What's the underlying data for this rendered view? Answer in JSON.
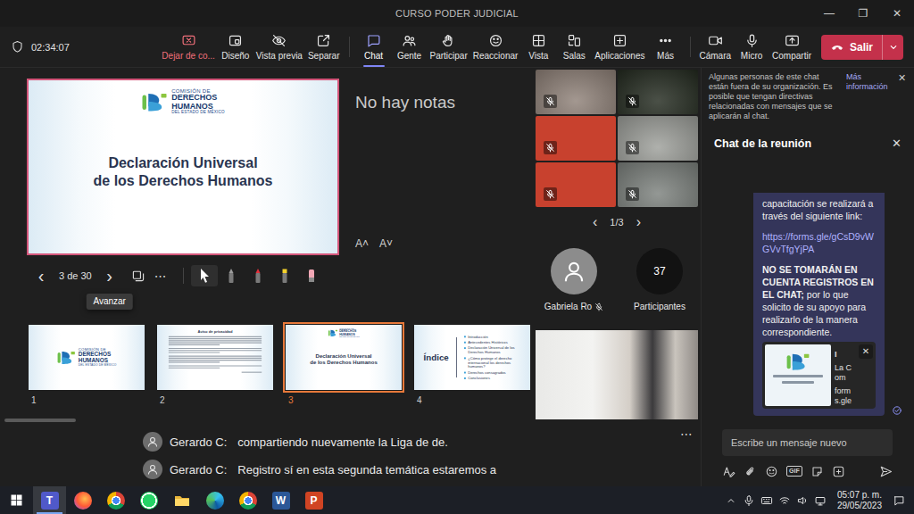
{
  "window": {
    "title": "CURSO PODER JUDICIAL",
    "controls": [
      "—",
      "❐",
      "✕"
    ]
  },
  "toolbar": {
    "timer": "02:34:07",
    "share_buttons": [
      {
        "label": "Dejar de co...",
        "kind": "stop",
        "selected": false
      },
      {
        "label": "Diseño",
        "kind": "normal",
        "selected": false
      },
      {
        "label": "Vista previa",
        "kind": "normal",
        "selected": false
      },
      {
        "label": "Separar",
        "kind": "normal",
        "selected": false
      }
    ],
    "meeting_buttons": [
      {
        "label": "Chat",
        "kind": "normal",
        "selected": true
      },
      {
        "label": "Gente",
        "kind": "normal",
        "selected": false
      },
      {
        "label": "Participar",
        "kind": "normal",
        "selected": false
      },
      {
        "label": "Reaccionar",
        "kind": "normal",
        "selected": false
      },
      {
        "label": "Vista",
        "kind": "normal",
        "selected": false
      },
      {
        "label": "Salas",
        "kind": "normal",
        "selected": false
      },
      {
        "label": "Aplicaciones",
        "kind": "normal",
        "selected": false
      },
      {
        "label": "Más",
        "kind": "normal",
        "selected": false
      }
    ],
    "device_buttons": [
      {
        "label": "Cámara",
        "kind": "normal",
        "selected": false
      },
      {
        "label": "Micro",
        "kind": "normal",
        "selected": false
      },
      {
        "label": "Compartir",
        "kind": "normal",
        "selected": false
      }
    ],
    "leave": {
      "label": "Salir"
    }
  },
  "presentation": {
    "logo": [
      {
        "text": "COMISIÓN DE",
        "kind": "small"
      },
      {
        "text": "DERECHOS",
        "kind": "big"
      },
      {
        "text": "HUMANOS",
        "kind": "big"
      },
      {
        "text": "DEL ESTADO DE MÉXICO",
        "kind": "tiny"
      }
    ],
    "notes": "No hay notas",
    "font_buttons": [
      "A˄",
      "A˅"
    ],
    "nav": {
      "prev": "‹",
      "page": "3 de 30",
      "next": "›",
      "tooltip": "Avanzar",
      "more": "⋯"
    },
    "tools": [
      {
        "kind": "pointer",
        "color": "#ffffff",
        "selected": true
      },
      {
        "kind": "pen",
        "color": "#9c9c9c",
        "selected": false
      },
      {
        "kind": "pen",
        "color": "#e2313c",
        "selected": false
      },
      {
        "kind": "highlighter",
        "color": "#f3d12c",
        "selected": false
      },
      {
        "kind": "eraser",
        "color": "#f2a7b5",
        "selected": false
      }
    ],
    "slides": [
      {
        "number": "1",
        "kind": "cover",
        "selected": false
      },
      {
        "number": "2",
        "kind": "notice",
        "title": "Aviso de privacidad",
        "selected": false
      },
      {
        "number": "3",
        "kind": "title",
        "title_lines": [
          "Declaración Universal",
          "de los Derechos Humanos"
        ],
        "selected": true
      },
      {
        "number": "4",
        "kind": "index",
        "title": "Índice",
        "items": [
          "Introducción",
          "Antecedentes Históricos",
          "Declaración Universal de los Derechos Humanos",
          "¿Cómo protege el derecho internacional los derechos humanos?",
          "Derechos consagrados",
          "Conclusiones"
        ],
        "selected": false
      }
    ]
  },
  "captions": [
    {
      "speaker": "Gerardo C:",
      "text": "compartiendo nuevamente la Liga de de."
    },
    {
      "speaker": "Gerardo C:",
      "text": "Registro sí en esta segunda temática estaremos a"
    }
  ],
  "videos": {
    "tiles": [
      {
        "kind": "photo",
        "color": "#8f8178",
        "muted": true
      },
      {
        "kind": "photo",
        "color": "#232a1f",
        "muted": true
      },
      {
        "kind": "avatar",
        "color": "#c8412e",
        "muted": true
      },
      {
        "kind": "photo",
        "color": "#9d9f9a",
        "muted": true
      },
      {
        "kind": "avatar",
        "color": "#c8412e",
        "muted": true
      },
      {
        "kind": "photo",
        "color": "#7c817d",
        "muted": true
      }
    ],
    "pager": {
      "prev": "‹",
      "label": "1/3",
      "next": "›"
    },
    "participant": {
      "name": "Gabriela Ro",
      "muted": true
    },
    "count": {
      "value": "37",
      "label": "Participantes"
    },
    "more": "⋯"
  },
  "chat": {
    "notice": {
      "text": "Algunas personas de este chat están fuera de su organización. Es posible que tengan directivas relacionadas con mensajes que se aplicarán al chat.",
      "link": "Más información",
      "close": "✕"
    },
    "title": "Chat de la reunión",
    "close": "✕",
    "message": {
      "text": "capacitación se realizará a través del siguiente link:",
      "link": "https://forms.gle/gCsD9vWGVvTfgYjPA",
      "bold": "NO SE TOMARÁN EN CUENTA REGISTROS EN EL CHAT;",
      "rest": "por lo que solicito de su apoyo para realizarlo de la manera correspondiente.",
      "card": {
        "title": "I",
        "text": "La Com",
        "domain": "forms.gle",
        "close": "✕"
      },
      "seen": true
    },
    "compose": {
      "placeholder": "Escribe un mensaje nuevo",
      "gif": "GIF"
    }
  },
  "taskbar": {
    "apps": [
      {
        "letter": "T",
        "selected": true
      },
      {
        "selected": false
      },
      {
        "selected": false
      },
      {
        "selected": false
      },
      {
        "selected": false
      },
      {
        "selected": false
      },
      {
        "selected": false
      },
      {
        "letter": "W",
        "selected": false
      },
      {
        "letter": "P",
        "selected": false
      }
    ],
    "time": "05:07 p. m.",
    "date": "29/05/2023"
  }
}
